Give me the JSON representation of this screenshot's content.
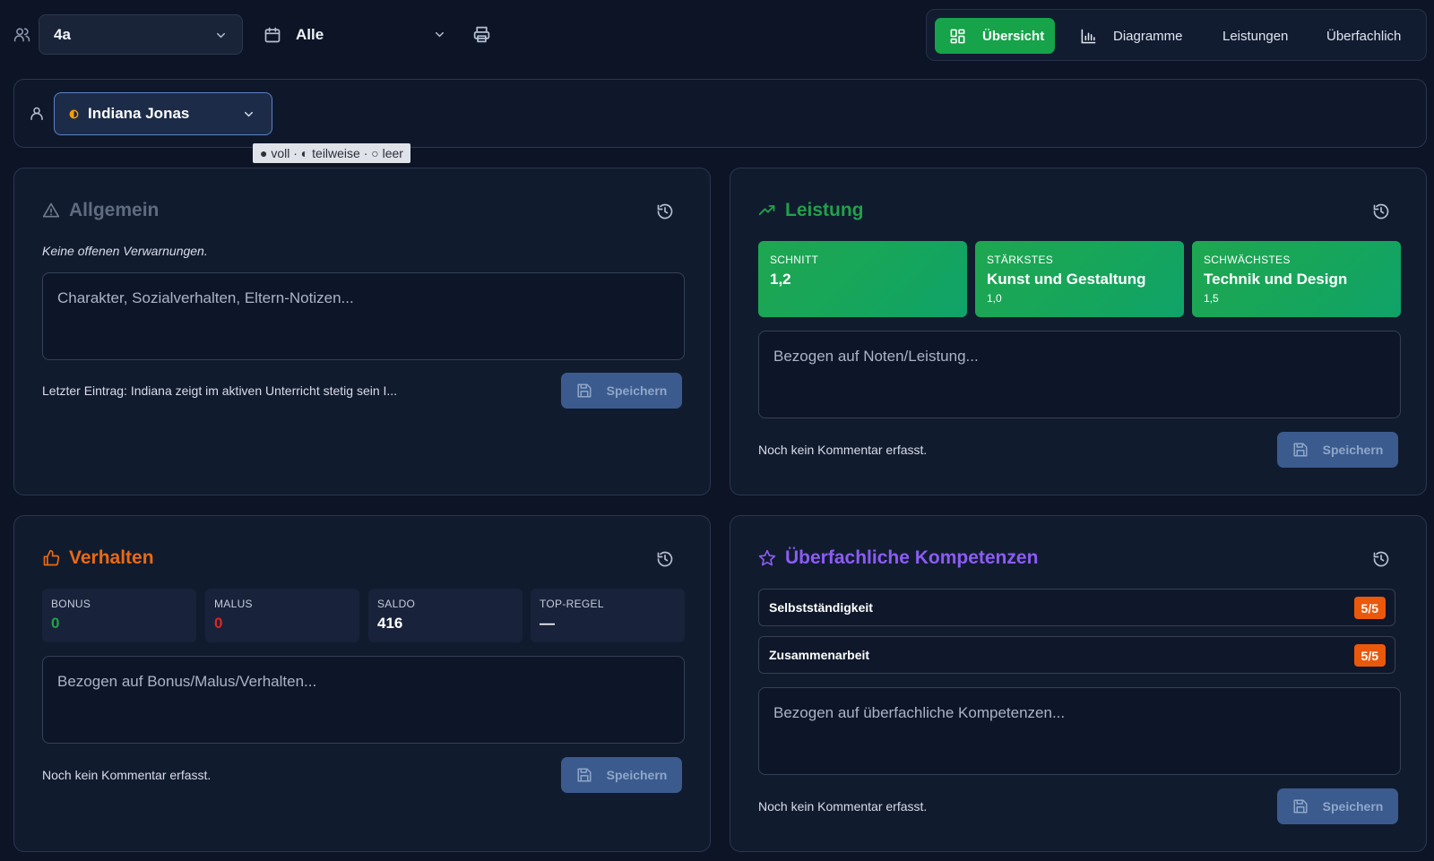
{
  "toolbar": {
    "class_value": "4a",
    "period_value": "Alle",
    "tabs": [
      {
        "label": "Übersicht",
        "icon": "grid-icon",
        "active": true
      },
      {
        "label": "Diagramme",
        "icon": "bar-chart-icon",
        "active": false
      },
      {
        "label": "Leistungen",
        "active": false
      },
      {
        "label": "Überfachlich",
        "active": false
      }
    ]
  },
  "student": {
    "name": "Indiana Jonas",
    "status_icon": "half-circle-icon",
    "legend": "● voll · ◐ teilweise · ○ leer"
  },
  "colors": {
    "accent_green": "#16a34a",
    "accent_orange": "#ea580c",
    "accent_purple": "#8b5cf6",
    "accent_blue": "#3b5b8e"
  },
  "general": {
    "title": "Allgemein",
    "note": "Keine offenen Verwarnungen.",
    "placeholder": "Charakter, Sozialverhalten, Eltern-Notizen...",
    "last_entry": "Letzter Eintrag: Indiana zeigt im aktiven Unterricht stetig sein I...",
    "save_label": "Speichern"
  },
  "performance": {
    "title": "Leistung",
    "tiles": [
      {
        "label": "SCHNITT",
        "value": "1,2",
        "sub": ""
      },
      {
        "label": "STÄRKSTES",
        "value": "Kunst und Gestaltung",
        "sub": "1,0"
      },
      {
        "label": "SCHWÄCHSTES",
        "value": "Technik und Design",
        "sub": "1,5"
      }
    ],
    "placeholder": "Bezogen auf Noten/Leistung...",
    "status": "Noch kein Kommentar erfasst.",
    "save_label": "Speichern"
  },
  "behavior": {
    "title": "Verhalten",
    "stats": [
      {
        "label": "BONUS",
        "value": "0",
        "color": "#22a04a"
      },
      {
        "label": "MALUS",
        "value": "0",
        "color": "#dc2626"
      },
      {
        "label": "SALDO",
        "value": "416",
        "color": "#ffffff"
      },
      {
        "label": "TOP-REGEL",
        "value": "—",
        "color": "#ffffff"
      }
    ],
    "placeholder": "Bezogen auf Bonus/Malus/Verhalten...",
    "status": "Noch kein Kommentar erfasst.",
    "save_label": "Speichern"
  },
  "competencies": {
    "title": "Überfachliche Kompetenzen",
    "items": [
      {
        "name": "Selbstständigkeit",
        "score": "5/5"
      },
      {
        "name": "Zusammenarbeit",
        "score": "5/5"
      }
    ],
    "placeholder": "Bezogen auf überfachliche Kompetenzen...",
    "status": "Noch kein Kommentar erfasst.",
    "save_label": "Speichern"
  }
}
